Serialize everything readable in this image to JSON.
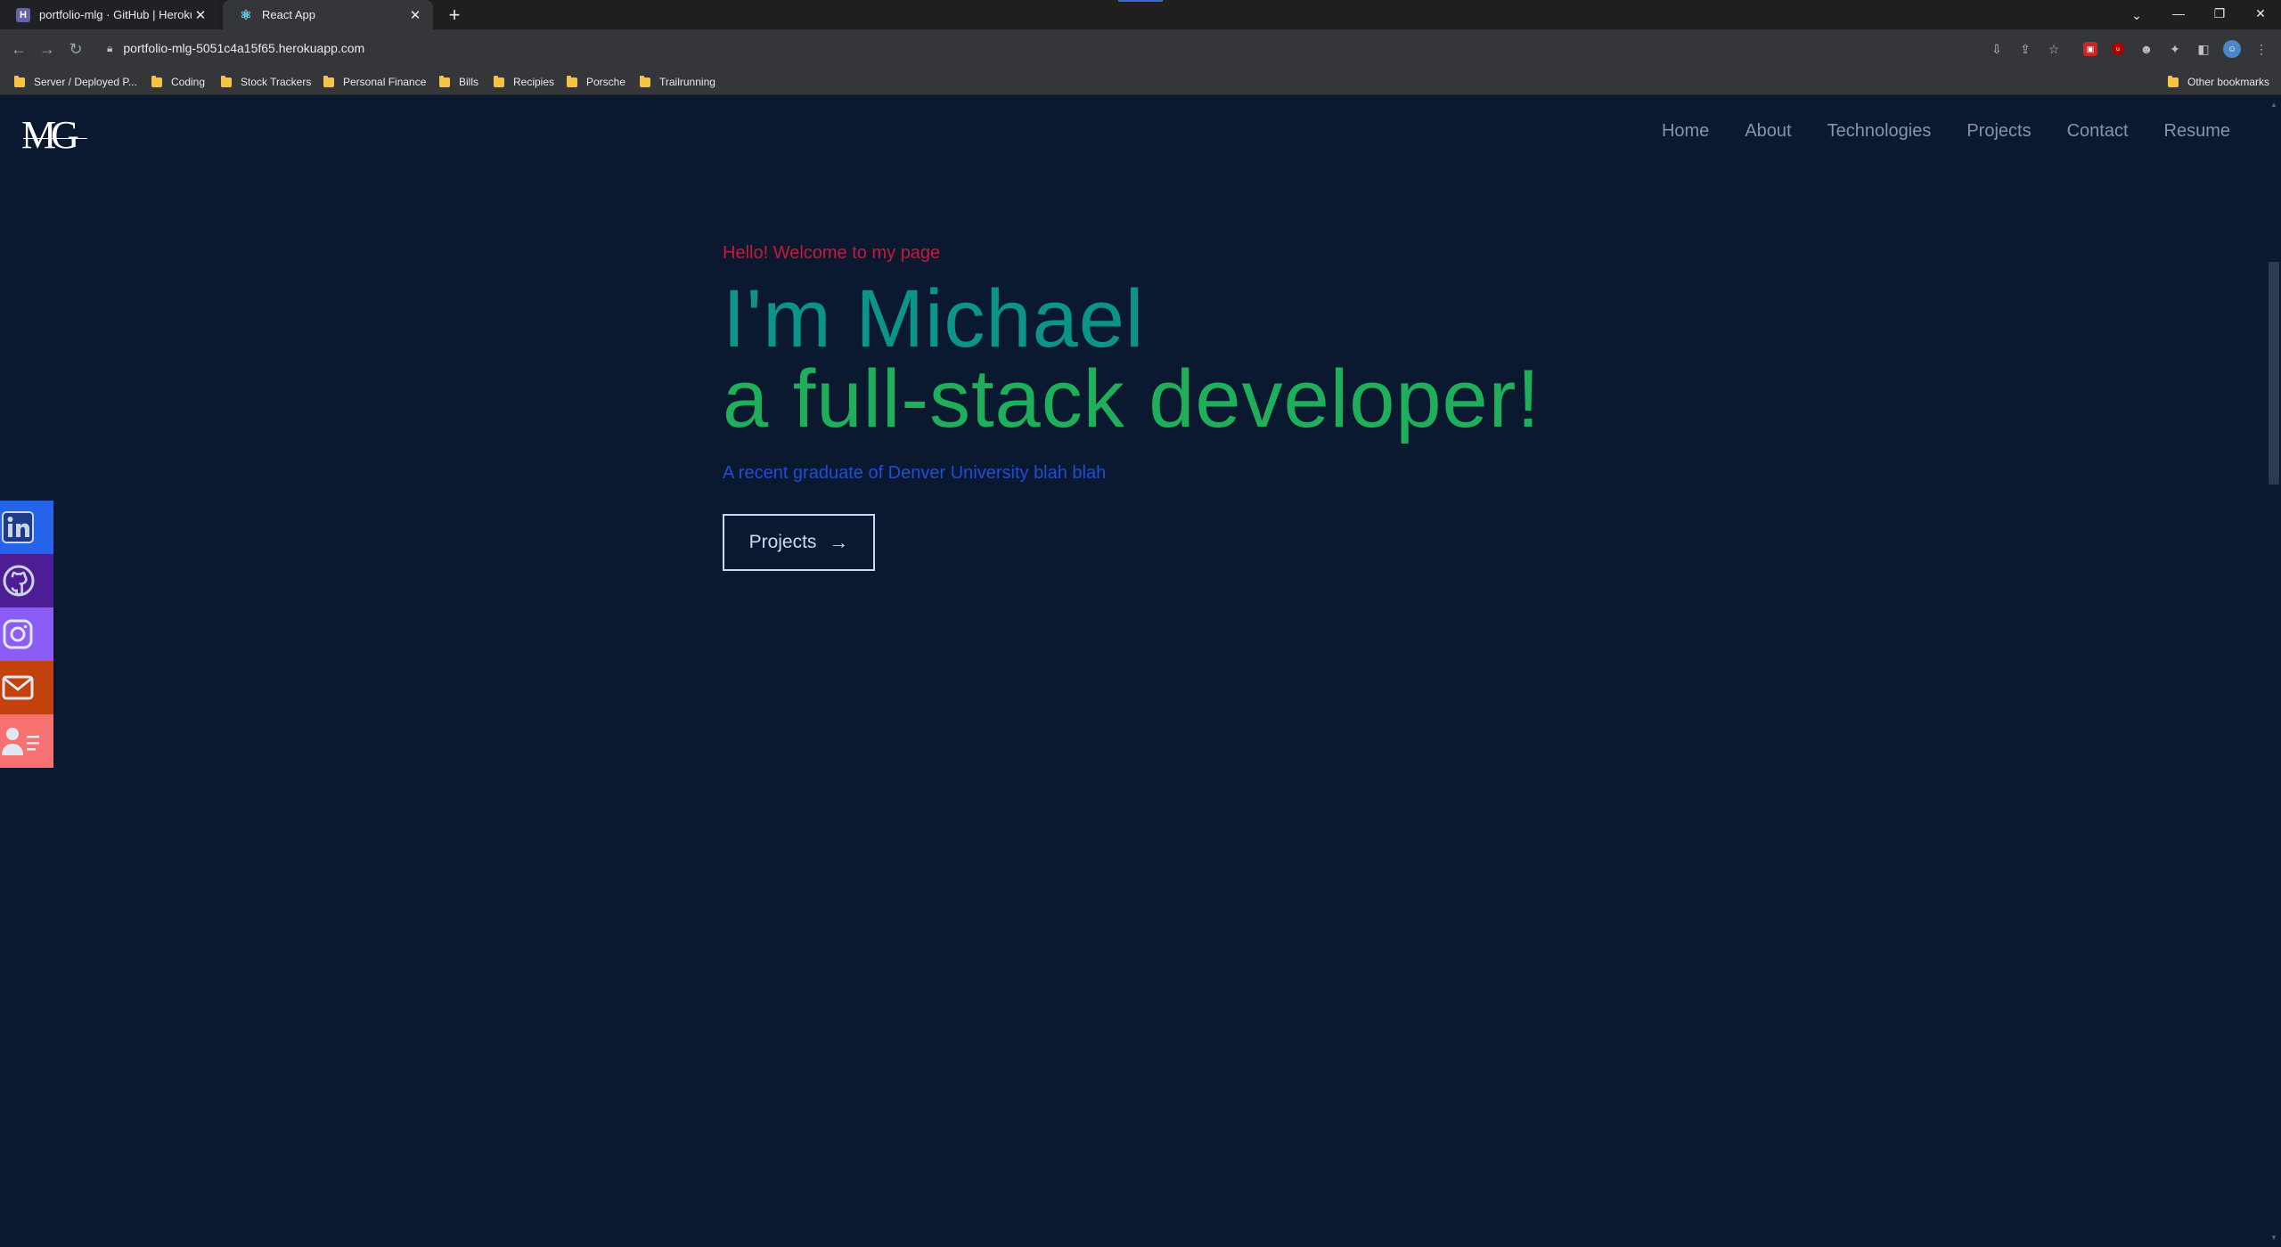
{
  "browser": {
    "tabs": [
      {
        "title": "portfolio-mlg · GitHub | Heroku",
        "favicon": "H"
      },
      {
        "title": "React App",
        "favicon": "⚛"
      }
    ],
    "url": "portfolio-mlg-5051c4a15f65.herokuapp.com",
    "bookmarks": [
      "Server / Deployed P...",
      "Coding",
      "Stock Trackers",
      "Personal Finance",
      "Bills",
      "Recipies",
      "Porsche",
      "Trailrunning"
    ],
    "other_bookmarks": "Other bookmarks"
  },
  "site": {
    "logo": "MG",
    "nav": [
      "Home",
      "About",
      "Technologies",
      "Projects",
      "Contact",
      "Resume"
    ],
    "hero": {
      "greeting": "Hello! Welcome to my page",
      "headline": "I'm Michael",
      "subhead": "a full-stack developer!",
      "tagline": "A recent graduate of Denver University blah blah",
      "cta_label": "Projects"
    },
    "social": [
      {
        "name": "linkedin-icon",
        "color": "#2563eb"
      },
      {
        "name": "github-icon",
        "color": "#4c1d95"
      },
      {
        "name": "instagram-icon",
        "color": "#8b5cf6"
      },
      {
        "name": "mail-icon",
        "color": "#c2410c"
      },
      {
        "name": "resume-icon",
        "color": "#f87171"
      }
    ]
  },
  "colors": {
    "page_bg": "#0a192f",
    "greeting": "#c8193b",
    "headline": "#0d9488",
    "subhead": "#1fae5a",
    "tagline": "#1d4ed8",
    "nav_text": "#8892b0"
  }
}
